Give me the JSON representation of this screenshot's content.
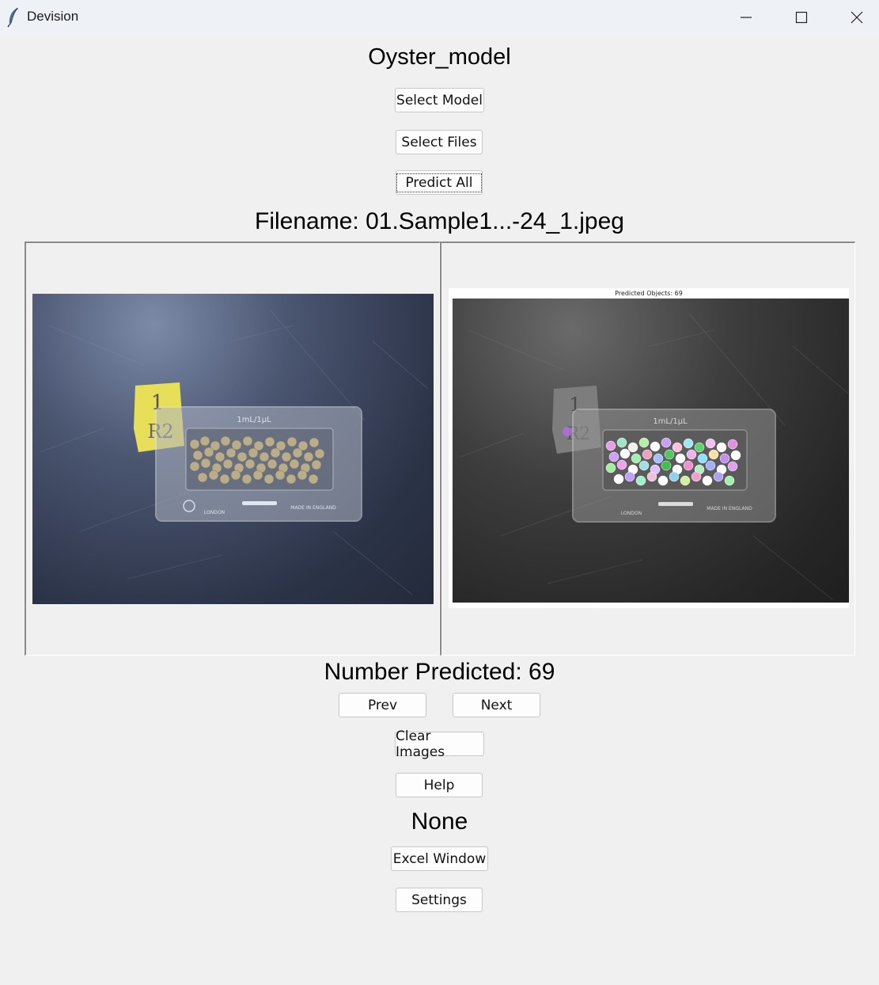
{
  "window": {
    "title": "Devision"
  },
  "main": {
    "model_title": "Oyster_model",
    "select_model_label": "Select Model",
    "select_files_label": "Select Files",
    "predict_all_label": "Predict All",
    "filename_text": "Filename: 01.Sample1...-24_1.jpeg",
    "number_predicted_text": "Number Predicted: 69",
    "prev_label": "Prev",
    "next_label": "Next",
    "clear_images_label": "Clear Images",
    "help_label": "Help",
    "status_text": "None",
    "excel_window_label": "Excel Window",
    "settings_label": "Settings"
  },
  "images": {
    "original": {
      "label_card": {
        "line1": "1",
        "line2": "R2"
      },
      "slide_top_text": "1mL/1µL",
      "slide_left_text": "LONDON",
      "slide_right_text": "MADE IN ENGLAND"
    },
    "predicted": {
      "header": "Predicted Objects: 69",
      "label_card": {
        "line1": "1",
        "line2": "R2"
      },
      "slide_top_text": "1mL/1µL",
      "slide_left_text": "LONDON",
      "slide_right_text": "MADE IN ENGLAND"
    }
  },
  "icons": {
    "app": "feather-icon",
    "minimize": "minimize-icon",
    "maximize": "maximize-icon",
    "close": "close-icon"
  }
}
